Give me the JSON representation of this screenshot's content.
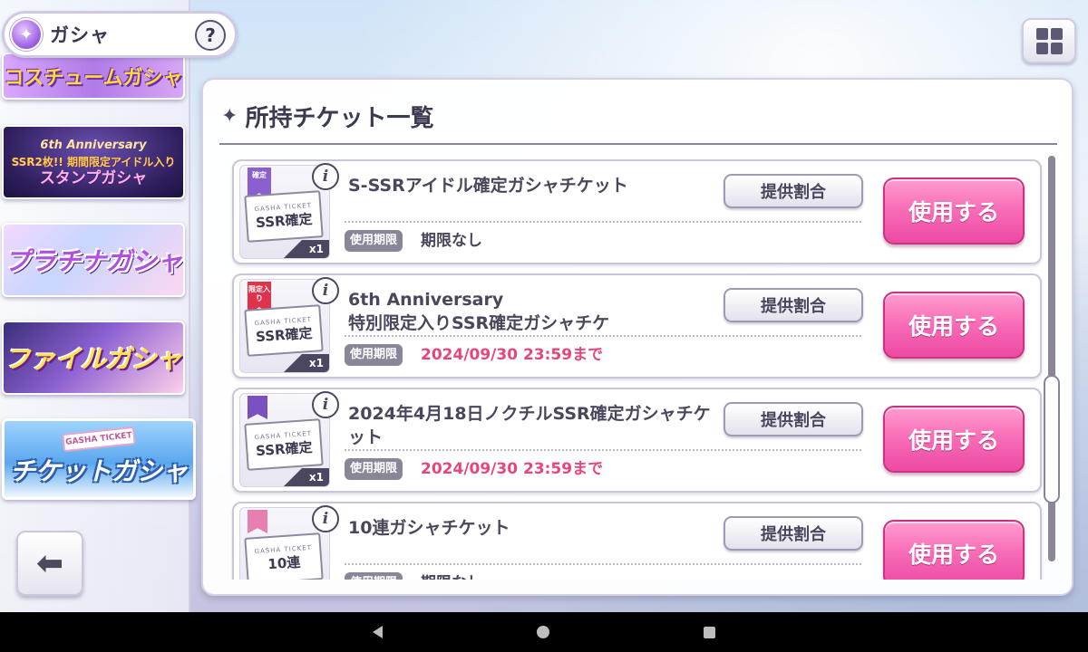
{
  "header": {
    "title": "ガシャ",
    "help_label": "?",
    "icon": "gacha-orb-icon"
  },
  "sidebar": {
    "banners": [
      {
        "label": "コスチュームガシャ"
      },
      {
        "line1": "6th Anniversary",
        "line2": "SSR2枚!! 期間限定アイドル入り",
        "line3": "スタンプガシャ"
      },
      {
        "label": "プラチナガシャ"
      },
      {
        "label": "ファイルガシャ"
      },
      {
        "label": "チケットガシャ",
        "mini": "GASHA TICKET"
      }
    ],
    "back_icon": "arrow-left-icon"
  },
  "menu_icon": "grid-menu-icon",
  "panel": {
    "title": "所持チケット一覧",
    "tickets": [
      {
        "name": "S-SSRアイドル確定ガシャチケット",
        "thumb_label": "SSR確定",
        "ribbon": "確定",
        "ribbon_color": "#8a5fd0",
        "count": "x1",
        "expiry_label": "使用期限",
        "expiry_value": "期限なし",
        "expiry_color": "#4a465c",
        "rate_label": "提供割合",
        "use_label": "使用する"
      },
      {
        "name": "6th Anniversary\n特別限定入りSSR確定ガシャチケ",
        "thumb_label": "SSR確定",
        "ribbon": "限定入り",
        "ribbon_color": "#e0324a",
        "count": "x1",
        "expiry_label": "使用期限",
        "expiry_value": "2024/09/30 23:59まで",
        "expiry_color": "#e8457a",
        "rate_label": "提供割合",
        "use_label": "使用する"
      },
      {
        "name": "2024年4月18日ノクチルSSR確定ガシャチケット",
        "thumb_label": "SSR確定",
        "ribbon": "",
        "ribbon_color": "#7a4fc0",
        "count": "x1",
        "expiry_label": "使用期限",
        "expiry_value": "2024/09/30 23:59まで",
        "expiry_color": "#e8457a",
        "rate_label": "提供割合",
        "use_label": "使用する"
      },
      {
        "name": "10連ガシャチケット",
        "thumb_label": "10連",
        "ribbon": "",
        "ribbon_color": "#e87fb0",
        "count": "",
        "expiry_label": "使用期限",
        "expiry_value": "期限なし",
        "expiry_color": "#4a465c",
        "rate_label": "提供割合",
        "use_label": "使用する"
      }
    ]
  },
  "colors": {
    "accent_pink": "#f86bb6",
    "panel_border": "#d4d1e2",
    "text_dark": "#4a465c"
  }
}
